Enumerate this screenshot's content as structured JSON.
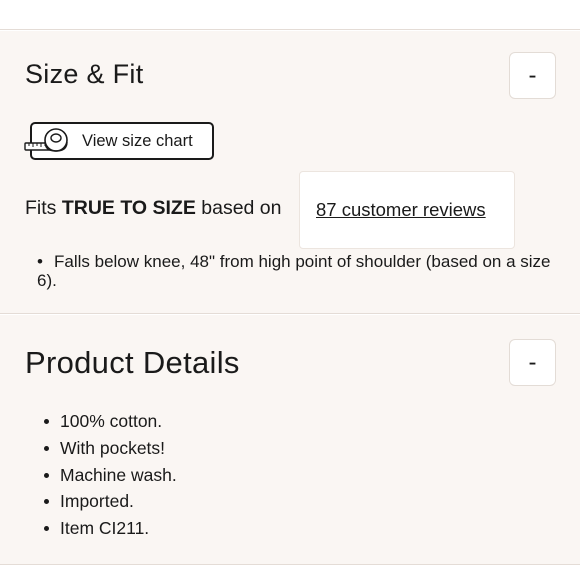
{
  "size_fit": {
    "title": "Size & Fit",
    "toggle_label": "-",
    "size_chart_label": "View size chart",
    "fits_prefix": "Fits ",
    "fits_emphasis": "TRUE TO SIZE",
    "fits_suffix": " based on",
    "reviews_link": "87 customer reviews",
    "note": "Falls below knee, 48\" from high point of shoulder (based on a size 6)."
  },
  "product_details": {
    "title": "Product Details",
    "toggle_label": "-",
    "items": [
      "100% cotton.",
      "With pockets!",
      "Machine wash.",
      "Imported.",
      "Item CI211."
    ]
  },
  "colors": {
    "panel_background": "#faf6f3",
    "text": "#1a1a1a",
    "border": "#e4dcd6"
  },
  "icons": {
    "size_chart": "tape-measure-icon",
    "bullet": "bullet-dot-icon"
  }
}
